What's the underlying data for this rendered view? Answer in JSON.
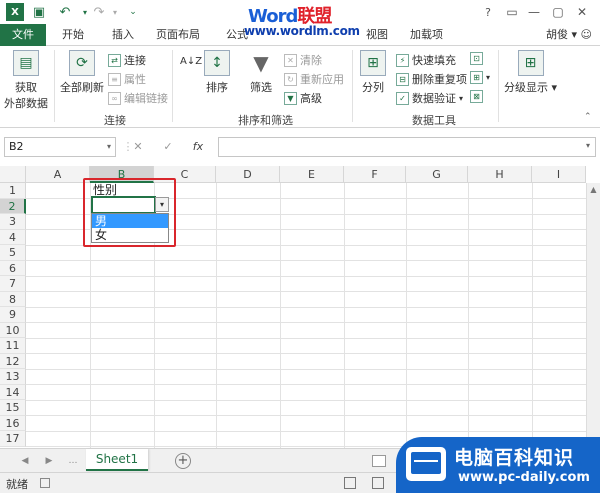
{
  "watermark": {
    "logo_part1": "Word",
    "logo_part2": "联盟",
    "url": "www.wordlm.com"
  },
  "title_bar": {
    "user": "胡俊",
    "help": "?"
  },
  "tabs": [
    {
      "label": "文件"
    },
    {
      "label": "开始"
    },
    {
      "label": "插入"
    },
    {
      "label": "页面布局"
    },
    {
      "label": "公式"
    },
    {
      "label": "视图"
    },
    {
      "label": "加载项"
    }
  ],
  "ribbon": {
    "get_external": [
      "获取",
      "外部数据"
    ],
    "refresh_all": "全部刷新",
    "connections": "连接",
    "properties": "属性",
    "edit_links": "编辑链接",
    "group_connections": "连接",
    "sort_az": "A↓Z",
    "sort": "排序",
    "filter": "筛选",
    "clear": "清除",
    "reapply": "重新应用",
    "advanced": "高级",
    "group_sort_filter": "排序和筛选",
    "text_to_columns": "分列",
    "flash_fill": "快速填充",
    "remove_dupes": "删除重复项",
    "data_validation": "数据验证",
    "group_data_tools": "数据工具",
    "outline": "分级显示"
  },
  "formula_bar": {
    "name_box": "B2",
    "cancel": "✕",
    "enter": "✓",
    "fx": "fx",
    "formula": ""
  },
  "columns": [
    "A",
    "B",
    "C",
    "D",
    "E",
    "F",
    "G",
    "H",
    "I"
  ],
  "rows": [
    "1",
    "2",
    "3",
    "4",
    "5",
    "6",
    "7",
    "8",
    "9",
    "10",
    "11",
    "12",
    "13",
    "14",
    "15",
    "16",
    "17"
  ],
  "cells": {
    "B1": "性别",
    "B2": ""
  },
  "dropdown": {
    "options": [
      "男",
      "女"
    ],
    "highlighted": 0
  },
  "sheet_tabs": {
    "active": "Sheet1",
    "add": "+"
  },
  "status": {
    "ready": "就绪"
  },
  "brand": {
    "title": "电脑百科知识",
    "url": "www.pc-daily.com"
  }
}
